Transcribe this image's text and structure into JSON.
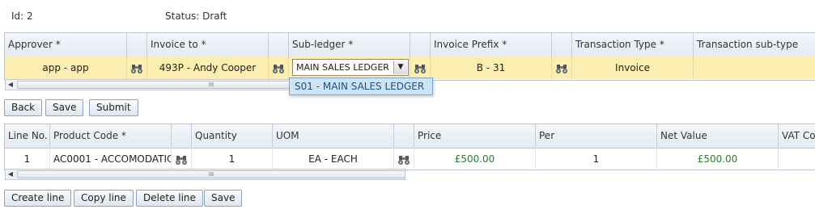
{
  "header": {
    "id_text": "Id: 2",
    "status_text": "Status: Draft"
  },
  "invoice_grid": {
    "columns": [
      "Approver *",
      "",
      "Invoice to *",
      "",
      "Sub-ledger *",
      "",
      "Invoice Prefix *",
      "",
      "Transaction Type *",
      "Transaction sub-type"
    ],
    "row": {
      "approver": "app - app",
      "invoice_to": "493P - Andy Cooper",
      "subledger_value": "MAIN SALES LEDGER",
      "invoice_prefix": "B - 31",
      "transaction_type": "Invoice",
      "transaction_subtype": ""
    },
    "dropdown_option": "S01 - MAIN SALES LEDGER"
  },
  "actions_top": {
    "back": "Back",
    "save": "Save",
    "submit": "Submit"
  },
  "lines_grid": {
    "columns": [
      "Line No.",
      "Product Code *",
      "",
      "Quantity",
      "UOM",
      "",
      "Price",
      "Per",
      "Net Value",
      "VAT Co"
    ],
    "rows": [
      {
        "line_no": "1",
        "product_code": "AC0001 - ACCOMODATIO",
        "quantity": "1",
        "uom": "EA - EACH",
        "price": "£500.00",
        "per": "1",
        "net_value": "£500.00"
      }
    ]
  },
  "actions_bottom": {
    "create_line": "Create line",
    "copy_line": "Copy line",
    "delete_line": "Delete line",
    "save": "Save"
  },
  "scrollbar": {
    "grip": "III"
  },
  "colors": {
    "selected_row": "#fbeeb0",
    "price_green": "#2e7d2e",
    "dropdown_bg": "#cfe3f7"
  }
}
